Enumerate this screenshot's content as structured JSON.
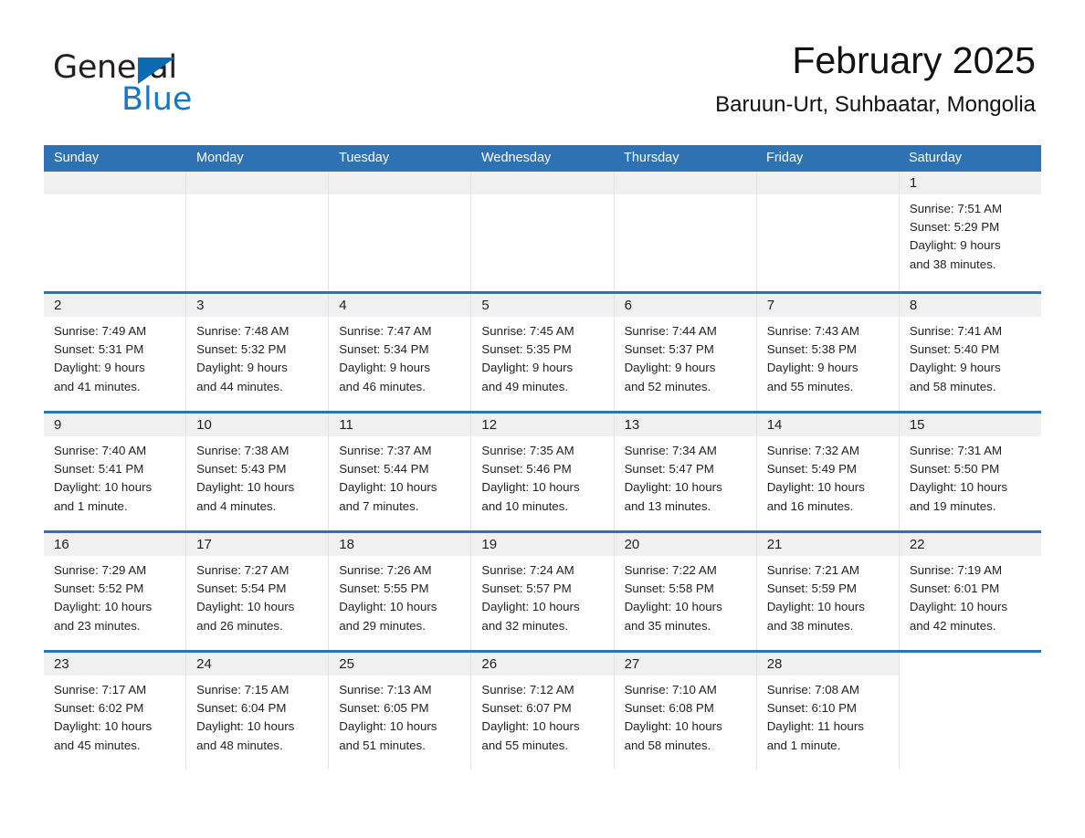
{
  "brand": {
    "word_one": "General",
    "word_two": "Blue",
    "triangle_color": "#0b6ab0",
    "blue_color": "#1478c8"
  },
  "header": {
    "month_title": "February 2025",
    "location": "Baruun-Urt, Suhbaatar, Mongolia"
  },
  "theme": {
    "header_blue": "#2f72b4",
    "daynum_gray": "#f0f0f0",
    "divider_gray": "#e3e3e3"
  },
  "weekday_headers": [
    "Sunday",
    "Monday",
    "Tuesday",
    "Wednesday",
    "Thursday",
    "Friday",
    "Saturday"
  ],
  "weeks": [
    [
      {
        "day": "",
        "lines": []
      },
      {
        "day": "",
        "lines": []
      },
      {
        "day": "",
        "lines": []
      },
      {
        "day": "",
        "lines": []
      },
      {
        "day": "",
        "lines": []
      },
      {
        "day": "",
        "lines": []
      },
      {
        "day": "1",
        "lines": [
          "Sunrise: 7:51 AM",
          "Sunset: 5:29 PM",
          "Daylight: 9 hours",
          "and 38 minutes."
        ]
      }
    ],
    [
      {
        "day": "2",
        "lines": [
          "Sunrise: 7:49 AM",
          "Sunset: 5:31 PM",
          "Daylight: 9 hours",
          "and 41 minutes."
        ]
      },
      {
        "day": "3",
        "lines": [
          "Sunrise: 7:48 AM",
          "Sunset: 5:32 PM",
          "Daylight: 9 hours",
          "and 44 minutes."
        ]
      },
      {
        "day": "4",
        "lines": [
          "Sunrise: 7:47 AM",
          "Sunset: 5:34 PM",
          "Daylight: 9 hours",
          "and 46 minutes."
        ]
      },
      {
        "day": "5",
        "lines": [
          "Sunrise: 7:45 AM",
          "Sunset: 5:35 PM",
          "Daylight: 9 hours",
          "and 49 minutes."
        ]
      },
      {
        "day": "6",
        "lines": [
          "Sunrise: 7:44 AM",
          "Sunset: 5:37 PM",
          "Daylight: 9 hours",
          "and 52 minutes."
        ]
      },
      {
        "day": "7",
        "lines": [
          "Sunrise: 7:43 AM",
          "Sunset: 5:38 PM",
          "Daylight: 9 hours",
          "and 55 minutes."
        ]
      },
      {
        "day": "8",
        "lines": [
          "Sunrise: 7:41 AM",
          "Sunset: 5:40 PM",
          "Daylight: 9 hours",
          "and 58 minutes."
        ]
      }
    ],
    [
      {
        "day": "9",
        "lines": [
          "Sunrise: 7:40 AM",
          "Sunset: 5:41 PM",
          "Daylight: 10 hours",
          "and 1 minute."
        ]
      },
      {
        "day": "10",
        "lines": [
          "Sunrise: 7:38 AM",
          "Sunset: 5:43 PM",
          "Daylight: 10 hours",
          "and 4 minutes."
        ]
      },
      {
        "day": "11",
        "lines": [
          "Sunrise: 7:37 AM",
          "Sunset: 5:44 PM",
          "Daylight: 10 hours",
          "and 7 minutes."
        ]
      },
      {
        "day": "12",
        "lines": [
          "Sunrise: 7:35 AM",
          "Sunset: 5:46 PM",
          "Daylight: 10 hours",
          "and 10 minutes."
        ]
      },
      {
        "day": "13",
        "lines": [
          "Sunrise: 7:34 AM",
          "Sunset: 5:47 PM",
          "Daylight: 10 hours",
          "and 13 minutes."
        ]
      },
      {
        "day": "14",
        "lines": [
          "Sunrise: 7:32 AM",
          "Sunset: 5:49 PM",
          "Daylight: 10 hours",
          "and 16 minutes."
        ]
      },
      {
        "day": "15",
        "lines": [
          "Sunrise: 7:31 AM",
          "Sunset: 5:50 PM",
          "Daylight: 10 hours",
          "and 19 minutes."
        ]
      }
    ],
    [
      {
        "day": "16",
        "lines": [
          "Sunrise: 7:29 AM",
          "Sunset: 5:52 PM",
          "Daylight: 10 hours",
          "and 23 minutes."
        ]
      },
      {
        "day": "17",
        "lines": [
          "Sunrise: 7:27 AM",
          "Sunset: 5:54 PM",
          "Daylight: 10 hours",
          "and 26 minutes."
        ]
      },
      {
        "day": "18",
        "lines": [
          "Sunrise: 7:26 AM",
          "Sunset: 5:55 PM",
          "Daylight: 10 hours",
          "and 29 minutes."
        ]
      },
      {
        "day": "19",
        "lines": [
          "Sunrise: 7:24 AM",
          "Sunset: 5:57 PM",
          "Daylight: 10 hours",
          "and 32 minutes."
        ]
      },
      {
        "day": "20",
        "lines": [
          "Sunrise: 7:22 AM",
          "Sunset: 5:58 PM",
          "Daylight: 10 hours",
          "and 35 minutes."
        ]
      },
      {
        "day": "21",
        "lines": [
          "Sunrise: 7:21 AM",
          "Sunset: 5:59 PM",
          "Daylight: 10 hours",
          "and 38 minutes."
        ]
      },
      {
        "day": "22",
        "lines": [
          "Sunrise: 7:19 AM",
          "Sunset: 6:01 PM",
          "Daylight: 10 hours",
          "and 42 minutes."
        ]
      }
    ],
    [
      {
        "day": "23",
        "lines": [
          "Sunrise: 7:17 AM",
          "Sunset: 6:02 PM",
          "Daylight: 10 hours",
          "and 45 minutes."
        ]
      },
      {
        "day": "24",
        "lines": [
          "Sunrise: 7:15 AM",
          "Sunset: 6:04 PM",
          "Daylight: 10 hours",
          "and 48 minutes."
        ]
      },
      {
        "day": "25",
        "lines": [
          "Sunrise: 7:13 AM",
          "Sunset: 6:05 PM",
          "Daylight: 10 hours",
          "and 51 minutes."
        ]
      },
      {
        "day": "26",
        "lines": [
          "Sunrise: 7:12 AM",
          "Sunset: 6:07 PM",
          "Daylight: 10 hours",
          "and 55 minutes."
        ]
      },
      {
        "day": "27",
        "lines": [
          "Sunrise: 7:10 AM",
          "Sunset: 6:08 PM",
          "Daylight: 10 hours",
          "and 58 minutes."
        ]
      },
      {
        "day": "28",
        "lines": [
          "Sunrise: 7:08 AM",
          "Sunset: 6:10 PM",
          "Daylight: 11 hours",
          "and 1 minute."
        ]
      },
      {
        "day": "",
        "lines": [],
        "blank": true
      }
    ]
  ]
}
